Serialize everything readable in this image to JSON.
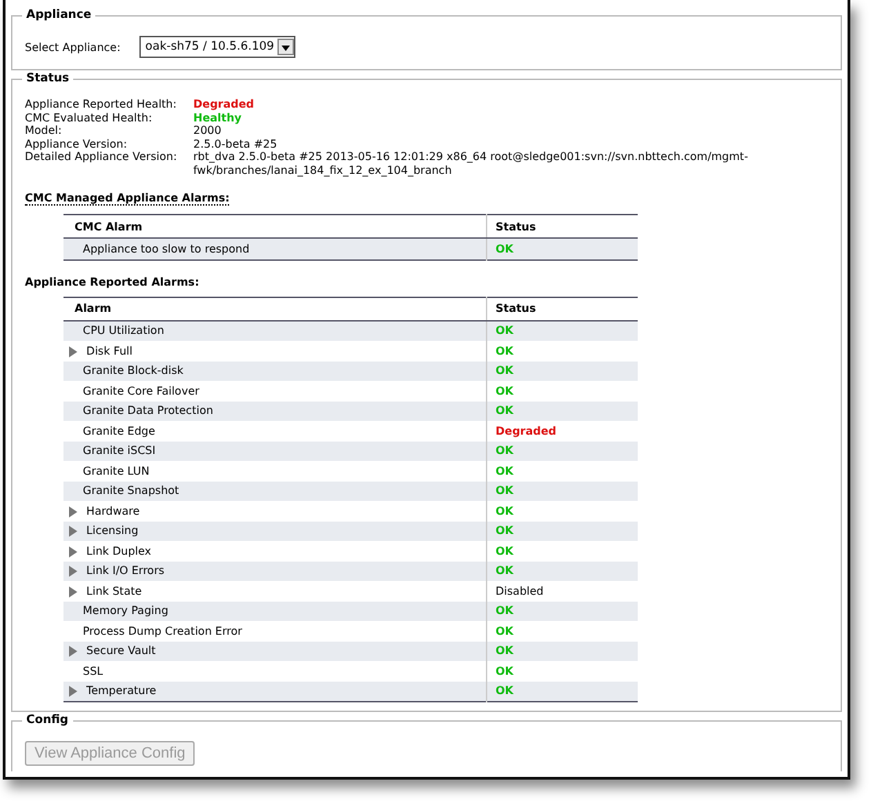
{
  "appliance": {
    "legend": "Appliance",
    "select_label": "Select Appliance:",
    "select_value": "oak-sh75 / 10.5.6.109"
  },
  "status": {
    "legend": "Status",
    "fields": [
      {
        "label": "Appliance Reported Health:",
        "value": "Degraded",
        "kind": "degraded"
      },
      {
        "label": "CMC Evaluated Health:",
        "value": "Healthy",
        "kind": "ok"
      },
      {
        "label": "Model:",
        "value": "2000",
        "kind": "plain"
      },
      {
        "label": "Appliance Version:",
        "value": "2.5.0-beta #25",
        "kind": "plain"
      },
      {
        "label": "Detailed Appliance Version:",
        "value": "rbt_dva 2.5.0-beta #25 2013-05-16 12:01:29 x86_64 root@sledge001:svn://svn.nbttech.com/mgmt-fwk/branches/lanai_184_fix_12_ex_104_branch",
        "kind": "plain"
      }
    ],
    "cmc_heading": "CMC Managed Appliance Alarms:",
    "cmc_table": {
      "columns": [
        "CMC Alarm",
        "Status"
      ],
      "rows": [
        {
          "alarm": "Appliance too slow to respond",
          "status": "OK",
          "kind": "ok",
          "expandable": false
        }
      ]
    },
    "reported_heading": "Appliance Reported Alarms:",
    "reported_table": {
      "columns": [
        "Alarm",
        "Status"
      ],
      "rows": [
        {
          "alarm": "CPU Utilization",
          "status": "OK",
          "kind": "ok",
          "expandable": false
        },
        {
          "alarm": "Disk Full",
          "status": "OK",
          "kind": "ok",
          "expandable": true
        },
        {
          "alarm": "Granite Block-disk",
          "status": "OK",
          "kind": "ok",
          "expandable": false
        },
        {
          "alarm": "Granite Core Failover",
          "status": "OK",
          "kind": "ok",
          "expandable": false
        },
        {
          "alarm": "Granite Data Protection",
          "status": "OK",
          "kind": "ok",
          "expandable": false
        },
        {
          "alarm": "Granite Edge",
          "status": "Degraded",
          "kind": "degraded",
          "expandable": false
        },
        {
          "alarm": "Granite iSCSI",
          "status": "OK",
          "kind": "ok",
          "expandable": false
        },
        {
          "alarm": "Granite LUN",
          "status": "OK",
          "kind": "ok",
          "expandable": false
        },
        {
          "alarm": "Granite Snapshot",
          "status": "OK",
          "kind": "ok",
          "expandable": false
        },
        {
          "alarm": "Hardware",
          "status": "OK",
          "kind": "ok",
          "expandable": true
        },
        {
          "alarm": "Licensing",
          "status": "OK",
          "kind": "ok",
          "expandable": true
        },
        {
          "alarm": "Link Duplex",
          "status": "OK",
          "kind": "ok",
          "expandable": true
        },
        {
          "alarm": "Link I/O Errors",
          "status": "OK",
          "kind": "ok",
          "expandable": true
        },
        {
          "alarm": "Link State",
          "status": "Disabled",
          "kind": "plain",
          "expandable": true
        },
        {
          "alarm": "Memory Paging",
          "status": "OK",
          "kind": "ok",
          "expandable": false
        },
        {
          "alarm": "Process Dump Creation Error",
          "status": "OK",
          "kind": "ok",
          "expandable": false
        },
        {
          "alarm": "Secure Vault",
          "status": "OK",
          "kind": "ok",
          "expandable": true
        },
        {
          "alarm": "SSL",
          "status": "OK",
          "kind": "ok",
          "expandable": false
        },
        {
          "alarm": "Temperature",
          "status": "OK",
          "kind": "ok",
          "expandable": true
        }
      ]
    }
  },
  "config": {
    "legend": "Config",
    "button": {
      "label": "View Appliance Config",
      "disabled": true
    }
  }
}
